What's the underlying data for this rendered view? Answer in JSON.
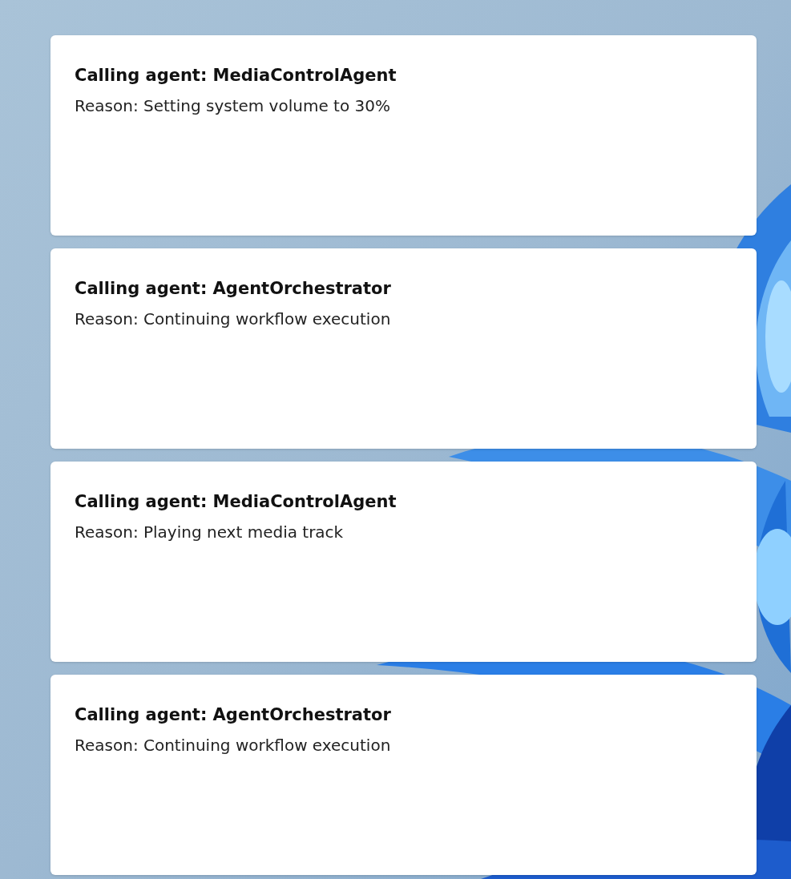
{
  "cards": [
    {
      "title": "Calling agent: MediaControlAgent",
      "reason": "Reason: Setting system volume to 30%"
    },
    {
      "title": "Calling agent: AgentOrchestrator",
      "reason": "Reason: Continuing workflow execution"
    },
    {
      "title": "Calling agent: MediaControlAgent",
      "reason": "Reason: Playing next media track"
    },
    {
      "title": "Calling agent: AgentOrchestrator",
      "reason": "Reason: Continuing workflow execution"
    }
  ]
}
